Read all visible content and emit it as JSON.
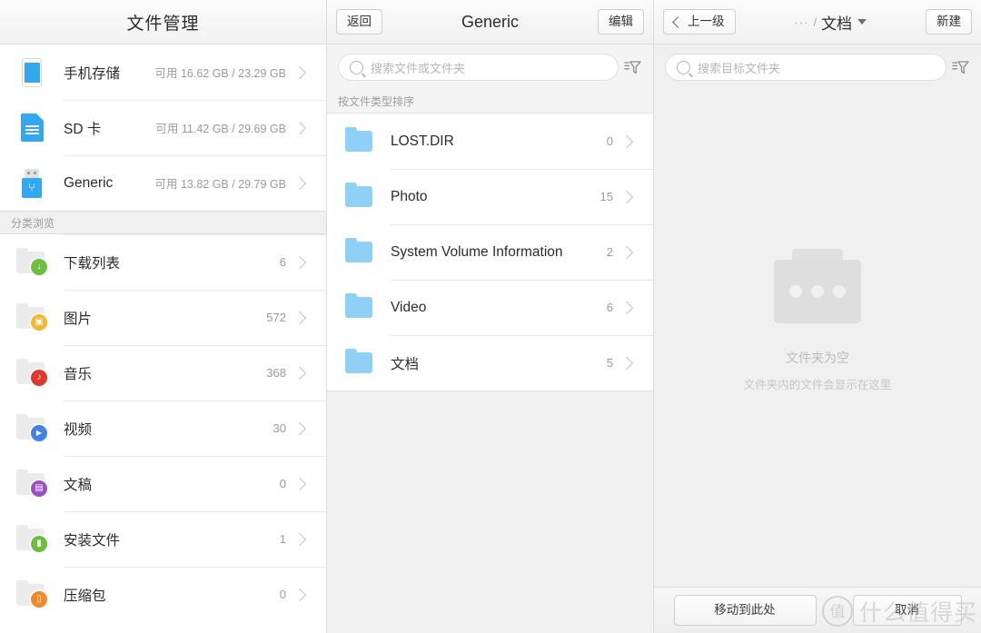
{
  "left": {
    "title": "文件管理",
    "storages": [
      {
        "icon": "phone-icon",
        "label": "手机存储",
        "meta": "可用 16.62 GB / 23.29 GB"
      },
      {
        "icon": "sd-card-icon",
        "label": "SD 卡",
        "meta": "可用 11.42 GB / 29.69 GB"
      },
      {
        "icon": "usb-drive-icon",
        "label": "Generic",
        "meta": "可用 13.82 GB / 29.79 GB"
      }
    ],
    "section_label": "分类浏览",
    "categories": [
      {
        "icon": "download-icon",
        "label": "下载列表",
        "count": "6",
        "color": "#6cbf3e"
      },
      {
        "icon": "image-icon",
        "label": "图片",
        "count": "572",
        "color": "#f5b731"
      },
      {
        "icon": "music-icon",
        "label": "音乐",
        "count": "368",
        "color": "#e0382f"
      },
      {
        "icon": "video-icon",
        "label": "视频",
        "count": "30",
        "color": "#3f84e5"
      },
      {
        "icon": "document-icon",
        "label": "文稿",
        "count": "0",
        "color": "#9b4fc4"
      },
      {
        "icon": "android-icon",
        "label": "安装文件",
        "count": "1",
        "color": "#6cbf3e"
      },
      {
        "icon": "archive-icon",
        "label": "压缩包",
        "count": "0",
        "color": "#ee8b28"
      }
    ]
  },
  "middle": {
    "back_label": "返回",
    "title": "Generic",
    "edit_label": "编辑",
    "search_placeholder": "搜索文件或文件夹",
    "sort_label": "按文件类型排序",
    "folders": [
      {
        "label": "LOST.DIR",
        "count": "0"
      },
      {
        "label": "Photo",
        "count": "15"
      },
      {
        "label": "System Volume Information",
        "count": "2"
      },
      {
        "label": "Video",
        "count": "6"
      },
      {
        "label": "文档",
        "count": "5"
      }
    ]
  },
  "right": {
    "up_label": "上一级",
    "crumb_dots": "···",
    "crumb_slash": "/",
    "crumb_name": "文档",
    "new_label": "新建",
    "search_placeholder": "搜索目标文件夹",
    "empty_title": "文件夹为空",
    "empty_sub": "文件夹内的文件会显示在这里",
    "move_here_label": "移动到此处",
    "cancel_label": "取消"
  },
  "watermark": {
    "badge": "值",
    "text": "什么值得买"
  },
  "icons": {
    "download_glyph": "↓",
    "image_glyph": "▣",
    "music_glyph": "♪",
    "video_glyph": "▶",
    "document_glyph": "▤",
    "android_glyph": "▮",
    "archive_glyph": "▯",
    "usb_glyph": "⑂"
  }
}
